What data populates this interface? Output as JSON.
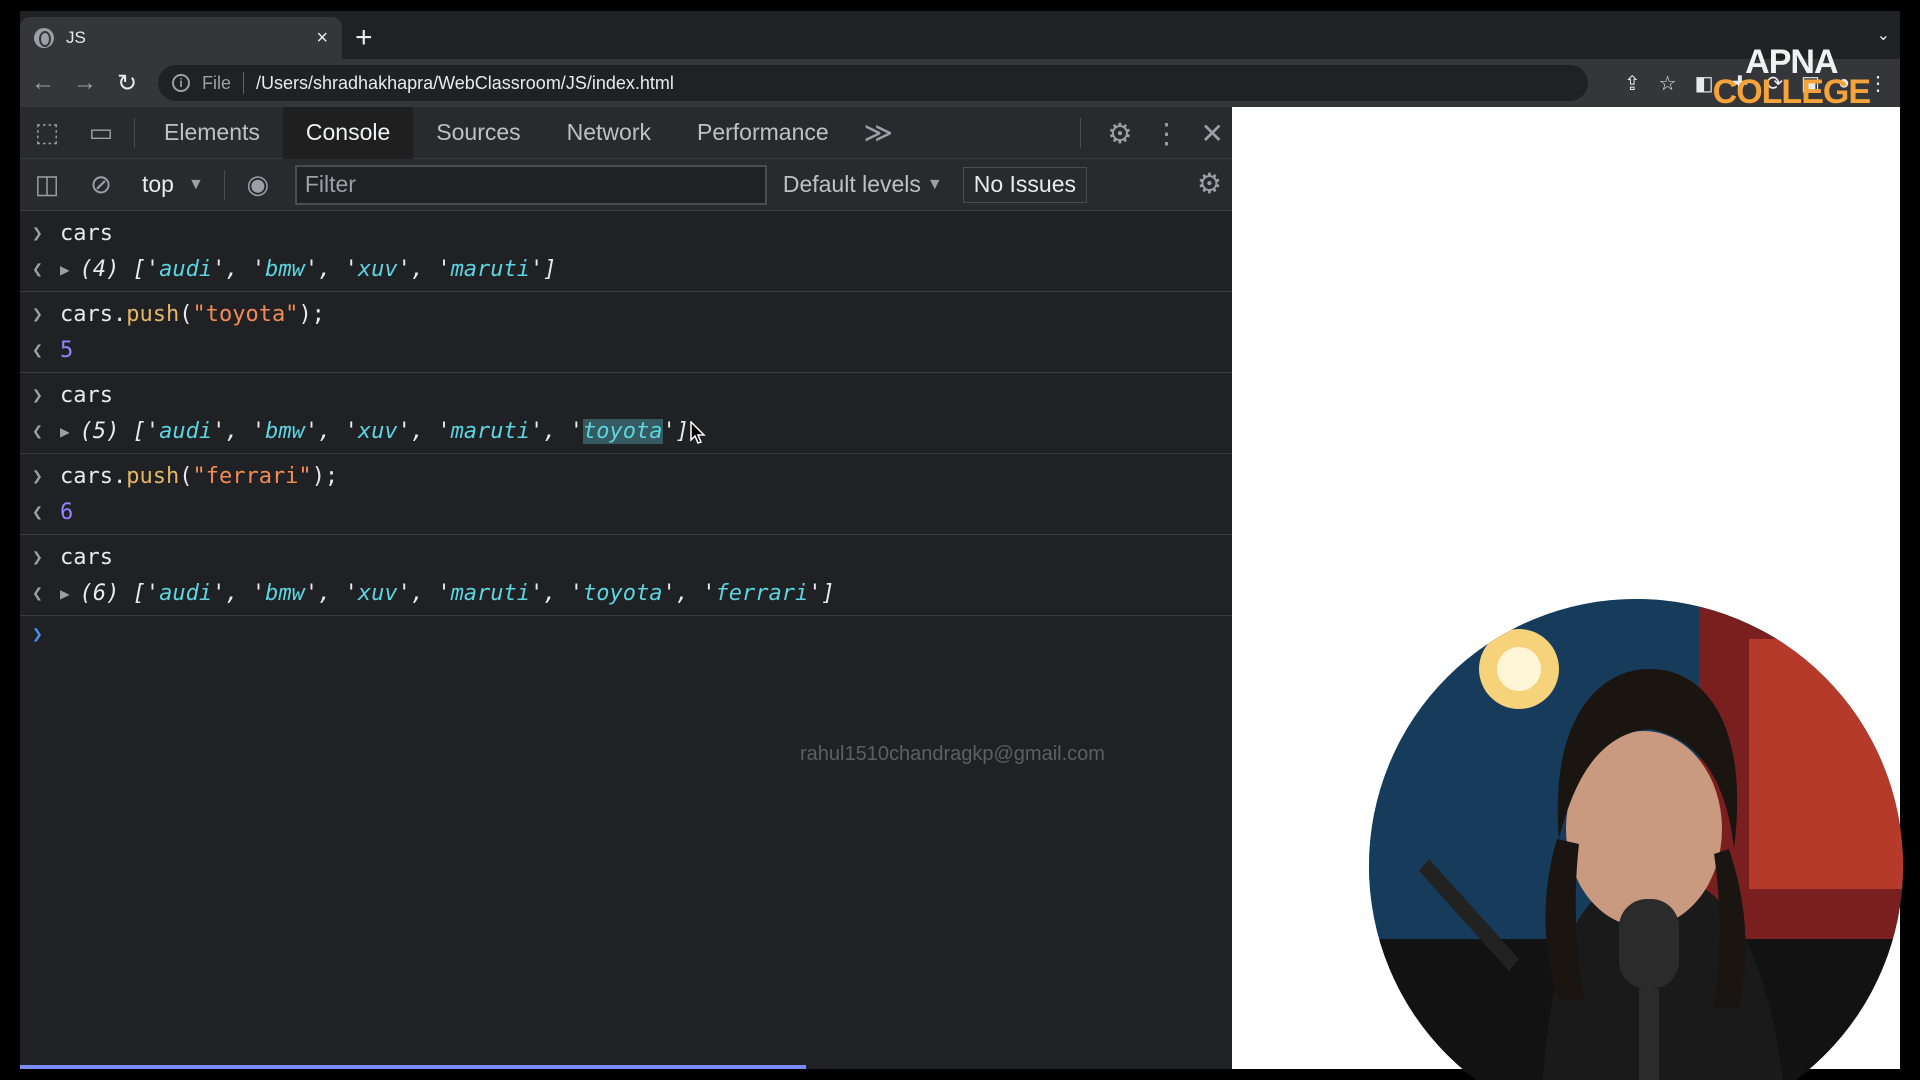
{
  "browser": {
    "tab_title": "JS",
    "tab_close": "×",
    "new_tab": "+",
    "tab_menu": "⌄",
    "omnibox_file": "File",
    "url": "/Users/shradhakhapra/WebClassroom/JS/index.html",
    "logo_top": "APNA",
    "logo_bottom": "COLLEGE"
  },
  "devtools": {
    "tabs": [
      {
        "label": "Elements"
      },
      {
        "label": "Console"
      },
      {
        "label": "Sources"
      },
      {
        "label": "Network"
      },
      {
        "label": "Performance"
      }
    ],
    "context": "top",
    "filter_placeholder": "Filter",
    "levels": "Default levels",
    "issues": "No Issues"
  },
  "console": {
    "entries": [
      {
        "input": "cars",
        "output": "(4) ['audi', 'bmw', 'xuv', 'maruti']"
      },
      {
        "input": "cars.push(\"toyota\");",
        "output": "5"
      },
      {
        "input": "cars",
        "output": "(5) ['audi', 'bmw', 'xuv', 'maruti', 'toyota']"
      },
      {
        "input": "cars.push(\"ferrari\");",
        "output": "6"
      },
      {
        "input": "cars",
        "output": "(6) ['audi', 'bmw', 'xuv', 'maruti', 'toyota', 'ferrari']"
      }
    ]
  },
  "watermark": "rahul1510chandragkp@gmail.com",
  "colors": {
    "accent": "#f4a43a",
    "progress": "#7c8cff"
  }
}
